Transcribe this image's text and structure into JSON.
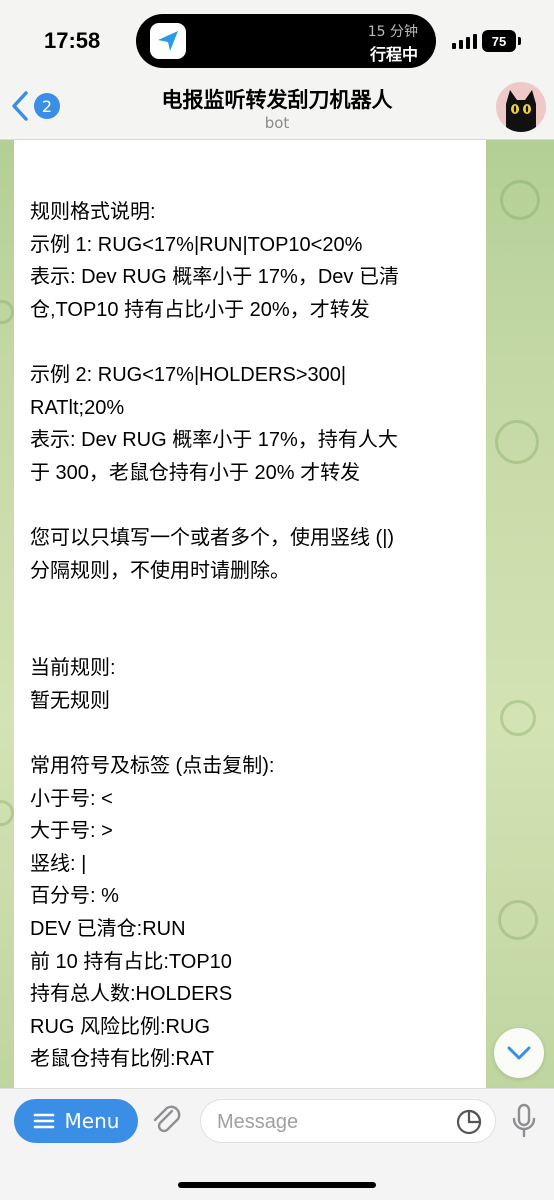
{
  "status_bar": {
    "time": "17:58",
    "island_line1": "15 分钟",
    "island_line2": "行程中",
    "battery": "75"
  },
  "header": {
    "back_badge": "2",
    "title": "电报监听转发刮刀机器人",
    "subtitle": "bot",
    "avatar": "black-cat-avatar"
  },
  "message": {
    "lines": [
      "规则格式说明:",
      "示例 1: RUG<17%|RUN|TOP10<20%",
      "表示: Dev RUG 概率小于 17%，Dev 已清",
      "仓,TOP10 持有占比小于 20%，才转发",
      "",
      "示例 2: RUG<17%|HOLDERS>300|",
      "RATlt;20%",
      "表示: Dev RUG 概率小于 17%，持有人大",
      "于 300，老鼠仓持有小于 20% 才转发",
      "",
      "您可以只填写一个或者多个，使用竖线 (|)",
      "分隔规则，不使用时请删除。",
      "",
      "",
      "当前规则:",
      "暂无规则",
      "",
      "常用符号及标签 (点击复制):",
      "小于号: <",
      "大于号: >",
      "竖线: |",
      "百分号: %",
      "DEV 已清仓:RUN",
      "前 10 持有占比:TOP10",
      "持有总人数:HOLDERS",
      "RUG 风险比例:RUG",
      "老鼠仓持有比例:RAT"
    ]
  },
  "input_bar": {
    "menu_label": "Menu",
    "placeholder": "Message"
  },
  "icons": {
    "back": "chevron-left-icon",
    "scroll": "chevron-down-icon",
    "attach": "paperclip-icon",
    "sticker": "sticker-icon",
    "mic": "microphone-icon"
  },
  "colors": {
    "accent": "#3a8ee6",
    "bubble": "#ffffff",
    "wallpaper": "#c3d8a4"
  }
}
